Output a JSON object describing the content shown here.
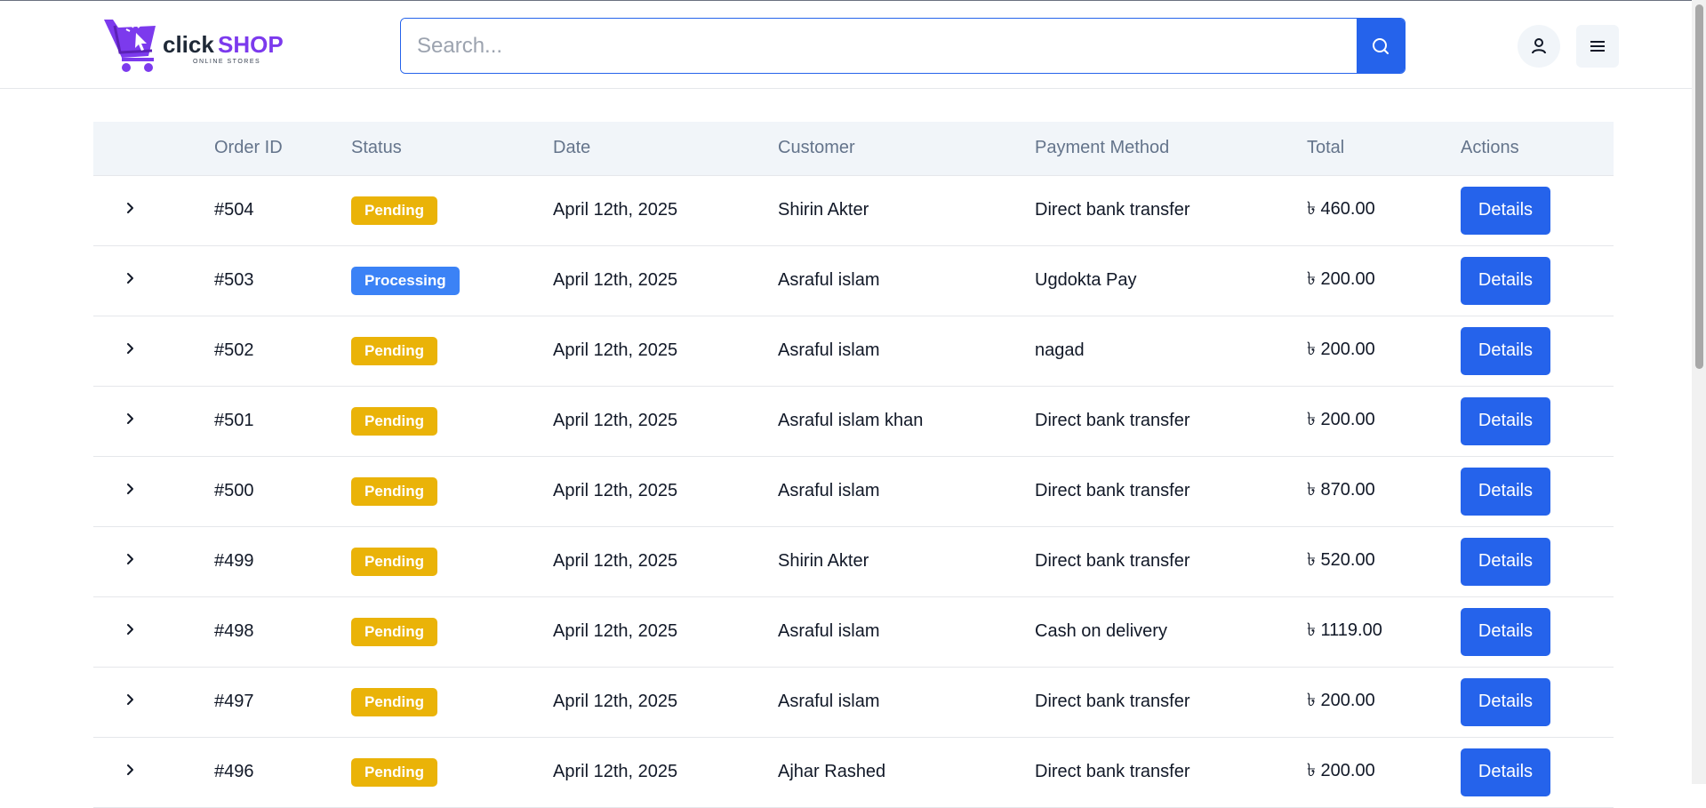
{
  "brand": {
    "name_part1": "click",
    "name_part2": "SHOP",
    "tagline": "ONLINE STORES",
    "accent": "#7c3aed",
    "dark": "#1f2937"
  },
  "search": {
    "placeholder": "Search..."
  },
  "header": {
    "user_icon": "user-icon",
    "menu_icon": "hamburger-icon",
    "search_icon": "search-icon"
  },
  "table": {
    "headers": [
      "",
      "Order ID",
      "Status",
      "Date",
      "Customer",
      "Payment Method",
      "Total",
      "Actions"
    ],
    "rows": [
      {
        "id": "#504",
        "status": "Pending",
        "status_type": "pending",
        "date": "April 12th, 2025",
        "customer": "Shirin Akter",
        "payment": "Direct bank transfer",
        "total": "৳ 460.00",
        "action": "Details"
      },
      {
        "id": "#503",
        "status": "Processing",
        "status_type": "processing",
        "date": "April 12th, 2025",
        "customer": "Asraful islam",
        "payment": "Ugdokta Pay",
        "total": "৳ 200.00",
        "action": "Details"
      },
      {
        "id": "#502",
        "status": "Pending",
        "status_type": "pending",
        "date": "April 12th, 2025",
        "customer": "Asraful islam",
        "payment": "nagad",
        "total": "৳ 200.00",
        "action": "Details"
      },
      {
        "id": "#501",
        "status": "Pending",
        "status_type": "pending",
        "date": "April 12th, 2025",
        "customer": "Asraful islam khan",
        "payment": "Direct bank transfer",
        "total": "৳ 200.00",
        "action": "Details"
      },
      {
        "id": "#500",
        "status": "Pending",
        "status_type": "pending",
        "date": "April 12th, 2025",
        "customer": "Asraful islam",
        "payment": "Direct bank transfer",
        "total": "৳ 870.00",
        "action": "Details"
      },
      {
        "id": "#499",
        "status": "Pending",
        "status_type": "pending",
        "date": "April 12th, 2025",
        "customer": "Shirin Akter",
        "payment": "Direct bank transfer",
        "total": "৳ 520.00",
        "action": "Details"
      },
      {
        "id": "#498",
        "status": "Pending",
        "status_type": "pending",
        "date": "April 12th, 2025",
        "customer": "Asraful islam",
        "payment": "Cash on delivery",
        "total": "৳ 1119.00",
        "action": "Details"
      },
      {
        "id": "#497",
        "status": "Pending",
        "status_type": "pending",
        "date": "April 12th, 2025",
        "customer": "Asraful islam",
        "payment": "Direct bank transfer",
        "total": "৳ 200.00",
        "action": "Details"
      },
      {
        "id": "#496",
        "status": "Pending",
        "status_type": "pending",
        "date": "April 12th, 2025",
        "customer": "Ajhar Rashed",
        "payment": "Direct bank transfer",
        "total": "৳ 200.00",
        "action": "Details"
      }
    ]
  },
  "colors": {
    "primary": "#2563eb",
    "pending": "#eab308",
    "processing": "#3b82f6",
    "header_bg": "#f1f5f9"
  }
}
